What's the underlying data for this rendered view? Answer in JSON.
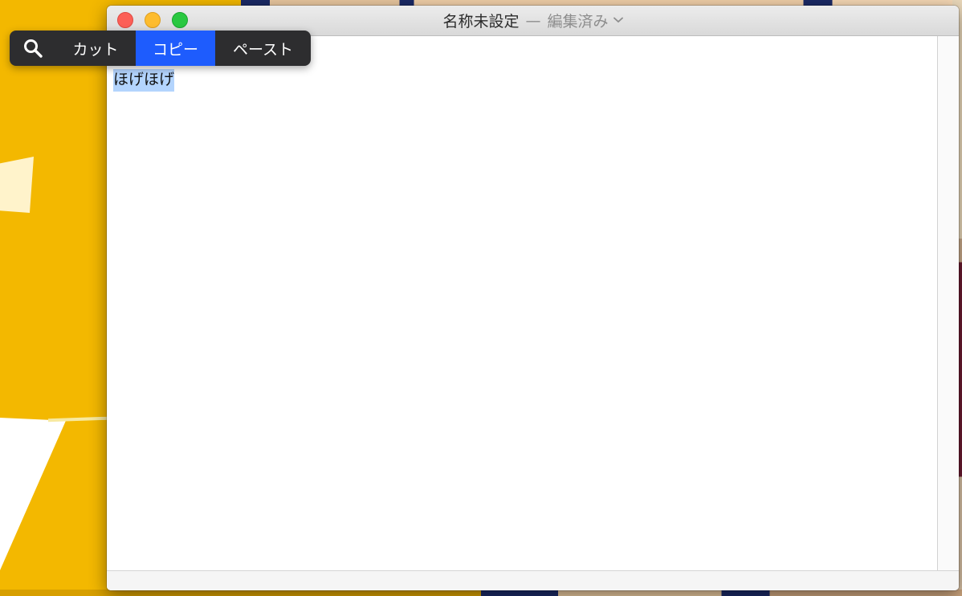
{
  "window": {
    "title": "名称未設定",
    "separator": "—",
    "status": "編集済み",
    "chevron_icon": "chevron-down-icon"
  },
  "editor": {
    "text": "ほげほげ",
    "selected": true
  },
  "edit_menu": {
    "search_icon": "magnifier-icon",
    "items": [
      {
        "label": "カット"
      },
      {
        "label": "コピー",
        "highlighted": true
      },
      {
        "label": "ペースト"
      }
    ],
    "highlight_color": "#1e5cfd"
  },
  "colors": {
    "close": "#fc5f57",
    "minimize": "#fdbc2e",
    "zoom": "#29c840",
    "selection": "#b3d4fd"
  }
}
